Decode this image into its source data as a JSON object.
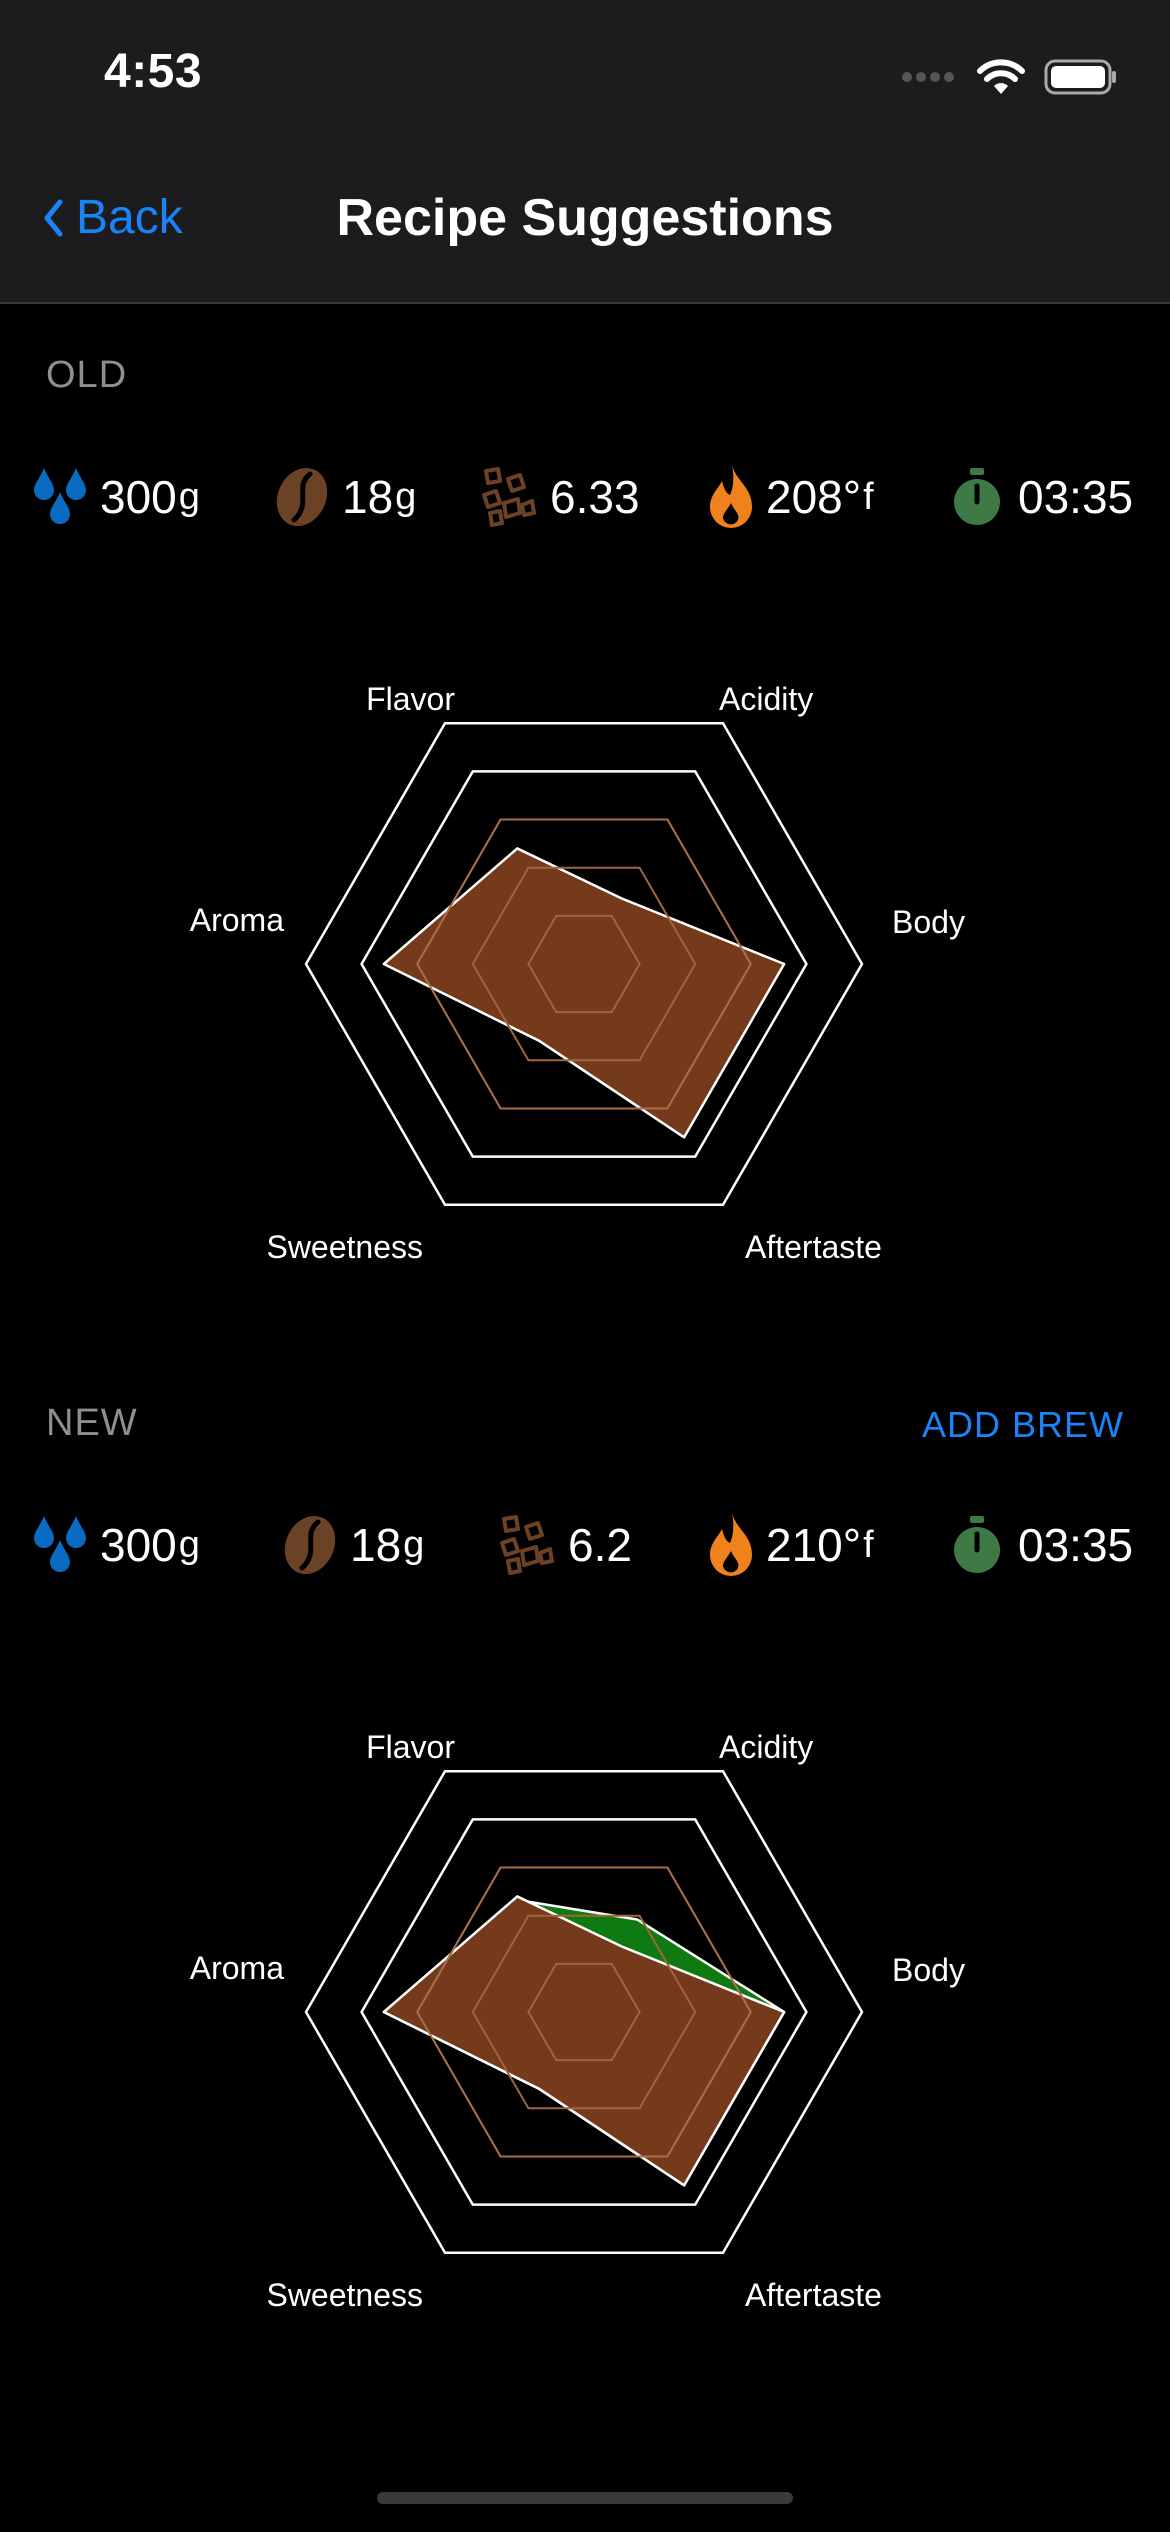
{
  "status_bar": {
    "time": "4:53"
  },
  "nav": {
    "back_label": "Back",
    "title": "Recipe Suggestions"
  },
  "old": {
    "label": "OLD",
    "water": {
      "value": "300",
      "unit": "g"
    },
    "coffee": {
      "value": "18",
      "unit": "g"
    },
    "grind": {
      "value": "6.33"
    },
    "temp": {
      "value": "208°",
      "unit": "f"
    },
    "time": {
      "value": "03:35"
    }
  },
  "new": {
    "label": "NEW",
    "add_brew_label": "ADD BREW",
    "water": {
      "value": "300",
      "unit": "g"
    },
    "coffee": {
      "value": "18",
      "unit": "g"
    },
    "grind": {
      "value": "6.2"
    },
    "temp": {
      "value": "210°",
      "unit": "f"
    },
    "time": {
      "value": "03:35"
    }
  },
  "colors": {
    "accent": "#1a84f6",
    "water": "#0a6bc2",
    "coffee_bean": "#6b4226",
    "flame": "#f0821e",
    "timer": "#3e7a45",
    "radar_fill": "#743a1b",
    "radar_new_fill": "#0f7a12"
  },
  "chart_data": [
    {
      "type": "radar",
      "axes": [
        "Flavor",
        "Acidity",
        "Body",
        "Aftertaste",
        "Sweetness",
        "Aroma"
      ],
      "range": [
        0,
        5
      ],
      "series": [
        {
          "values": [
            3,
            1.7,
            4.5,
            4.5,
            2,
            4.5
          ]
        }
      ]
    },
    {
      "type": "radar",
      "axes": [
        "Flavor",
        "Acidity",
        "Body",
        "Aftertaste",
        "Sweetness",
        "Aroma"
      ],
      "range": [
        0,
        5
      ],
      "series": [
        {
          "values": [
            2.9,
            2.4,
            4.5,
            4.5,
            2,
            4.5
          ]
        },
        {
          "values": [
            3,
            1.7,
            4.5,
            4.5,
            2,
            4.5
          ]
        }
      ]
    }
  ]
}
